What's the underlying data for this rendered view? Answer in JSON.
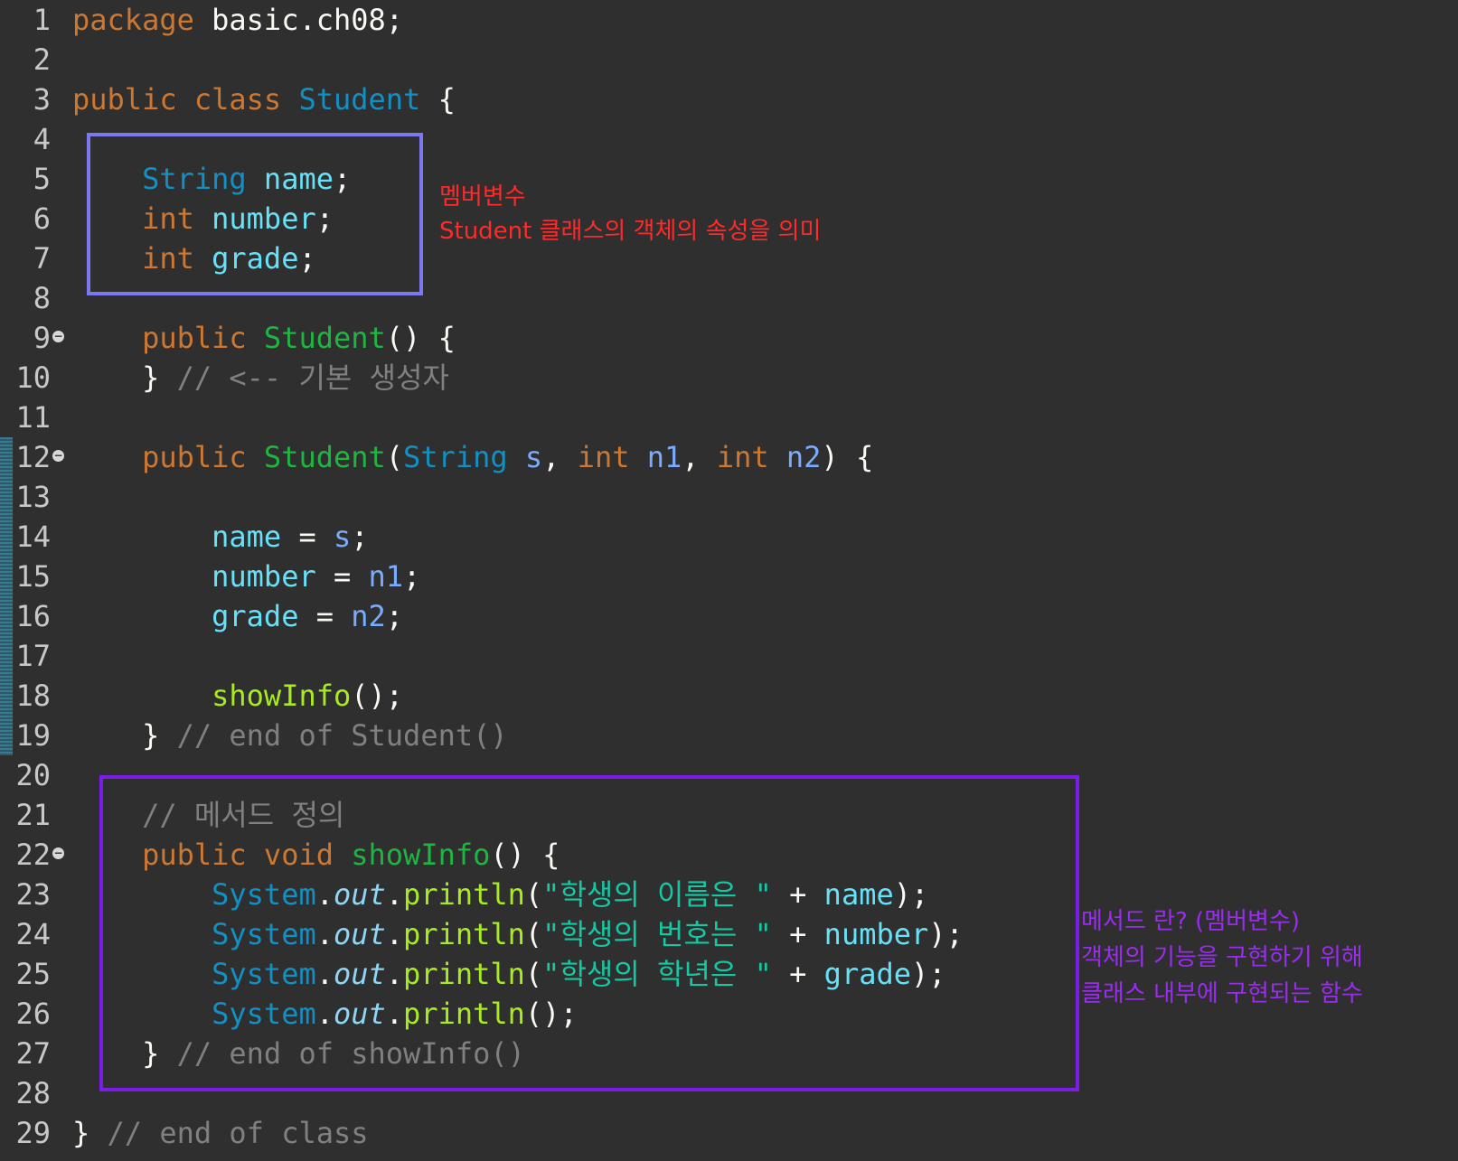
{
  "editor": {
    "lines": [
      {
        "n": "1",
        "tokens": [
          {
            "c": "kw",
            "t": "package"
          },
          {
            "c": "pl",
            "t": " basic.ch08;"
          }
        ]
      },
      {
        "n": "2",
        "tokens": []
      },
      {
        "n": "3",
        "tokens": [
          {
            "c": "kw",
            "t": "public class "
          },
          {
            "c": "ty",
            "t": "Student"
          },
          {
            "c": "pl",
            "t": " {"
          }
        ]
      },
      {
        "n": "4",
        "tokens": []
      },
      {
        "n": "5",
        "tokens": [
          {
            "c": "pl",
            "t": "    "
          },
          {
            "c": "ty",
            "t": "String"
          },
          {
            "c": "pl",
            "t": " "
          },
          {
            "c": "fld",
            "t": "name"
          },
          {
            "c": "pl",
            "t": ";"
          }
        ]
      },
      {
        "n": "6",
        "tokens": [
          {
            "c": "pl",
            "t": "    "
          },
          {
            "c": "kw",
            "t": "int"
          },
          {
            "c": "pl",
            "t": " "
          },
          {
            "c": "fld",
            "t": "number"
          },
          {
            "c": "pl",
            "t": ";"
          }
        ]
      },
      {
        "n": "7",
        "tokens": [
          {
            "c": "pl",
            "t": "    "
          },
          {
            "c": "kw",
            "t": "int"
          },
          {
            "c": "pl",
            "t": " "
          },
          {
            "c": "fld",
            "t": "grade"
          },
          {
            "c": "pl",
            "t": ";"
          }
        ]
      },
      {
        "n": "8",
        "tokens": []
      },
      {
        "n": "9",
        "fold": true,
        "tokens": [
          {
            "c": "pl",
            "t": "    "
          },
          {
            "c": "kw",
            "t": "public"
          },
          {
            "c": "pl",
            "t": " "
          },
          {
            "c": "meth",
            "t": "Student"
          },
          {
            "c": "pl",
            "t": "() {"
          }
        ]
      },
      {
        "n": "10",
        "tokens": [
          {
            "c": "pl",
            "t": "    } "
          },
          {
            "c": "cmt",
            "t": "// <-- 기본 생성자"
          }
        ]
      },
      {
        "n": "11",
        "tokens": []
      },
      {
        "n": "12",
        "fold": true,
        "tokens": [
          {
            "c": "pl",
            "t": "    "
          },
          {
            "c": "kw",
            "t": "public"
          },
          {
            "c": "pl",
            "t": " "
          },
          {
            "c": "meth",
            "t": "Student"
          },
          {
            "c": "pl",
            "t": "("
          },
          {
            "c": "ty",
            "t": "String"
          },
          {
            "c": "pl",
            "t": " "
          },
          {
            "c": "param",
            "t": "s"
          },
          {
            "c": "pl",
            "t": ", "
          },
          {
            "c": "kw",
            "t": "int"
          },
          {
            "c": "pl",
            "t": " "
          },
          {
            "c": "param",
            "t": "n1"
          },
          {
            "c": "pl",
            "t": ", "
          },
          {
            "c": "kw",
            "t": "int"
          },
          {
            "c": "pl",
            "t": " "
          },
          {
            "c": "param",
            "t": "n2"
          },
          {
            "c": "pl",
            "t": ") {"
          }
        ]
      },
      {
        "n": "13",
        "tokens": []
      },
      {
        "n": "14",
        "tokens": [
          {
            "c": "pl",
            "t": "        "
          },
          {
            "c": "fld",
            "t": "name"
          },
          {
            "c": "pl",
            "t": " = "
          },
          {
            "c": "param",
            "t": "s"
          },
          {
            "c": "pl",
            "t": ";"
          }
        ]
      },
      {
        "n": "15",
        "tokens": [
          {
            "c": "pl",
            "t": "        "
          },
          {
            "c": "fld",
            "t": "number"
          },
          {
            "c": "pl",
            "t": " = "
          },
          {
            "c": "param",
            "t": "n1"
          },
          {
            "c": "pl",
            "t": ";"
          }
        ]
      },
      {
        "n": "16",
        "tokens": [
          {
            "c": "pl",
            "t": "        "
          },
          {
            "c": "fld",
            "t": "grade"
          },
          {
            "c": "pl",
            "t": " = "
          },
          {
            "c": "param",
            "t": "n2"
          },
          {
            "c": "pl",
            "t": ";"
          }
        ]
      },
      {
        "n": "17",
        "tokens": []
      },
      {
        "n": "18",
        "tokens": [
          {
            "c": "pl",
            "t": "        "
          },
          {
            "c": "call",
            "t": "showInfo"
          },
          {
            "c": "pl",
            "t": "();"
          }
        ]
      },
      {
        "n": "19",
        "tokens": [
          {
            "c": "pl",
            "t": "    } "
          },
          {
            "c": "cmt",
            "t": "// end of Student()"
          }
        ]
      },
      {
        "n": "20",
        "tokens": []
      },
      {
        "n": "21",
        "tokens": [
          {
            "c": "pl",
            "t": "    "
          },
          {
            "c": "cmt",
            "t": "// 메서드 정의"
          }
        ]
      },
      {
        "n": "22",
        "fold": true,
        "tokens": [
          {
            "c": "pl",
            "t": "    "
          },
          {
            "c": "kw",
            "t": "public void"
          },
          {
            "c": "pl",
            "t": " "
          },
          {
            "c": "meth",
            "t": "showInfo"
          },
          {
            "c": "pl",
            "t": "() {"
          }
        ]
      },
      {
        "n": "23",
        "tokens": [
          {
            "c": "pl",
            "t": "        "
          },
          {
            "c": "ty",
            "t": "System"
          },
          {
            "c": "pl",
            "t": "."
          },
          {
            "c": "st",
            "t": "out"
          },
          {
            "c": "pl",
            "t": "."
          },
          {
            "c": "call",
            "t": "println"
          },
          {
            "c": "pl",
            "t": "("
          },
          {
            "c": "str",
            "t": "\"학생의 이름은 \""
          },
          {
            "c": "pl",
            "t": " + "
          },
          {
            "c": "fld",
            "t": "name"
          },
          {
            "c": "pl",
            "t": ");"
          }
        ]
      },
      {
        "n": "24",
        "tokens": [
          {
            "c": "pl",
            "t": "        "
          },
          {
            "c": "ty",
            "t": "System"
          },
          {
            "c": "pl",
            "t": "."
          },
          {
            "c": "st",
            "t": "out"
          },
          {
            "c": "pl",
            "t": "."
          },
          {
            "c": "call",
            "t": "println"
          },
          {
            "c": "pl",
            "t": "("
          },
          {
            "c": "str",
            "t": "\"학생의 번호는 \""
          },
          {
            "c": "pl",
            "t": " + "
          },
          {
            "c": "fld",
            "t": "number"
          },
          {
            "c": "pl",
            "t": ");"
          }
        ]
      },
      {
        "n": "25",
        "tokens": [
          {
            "c": "pl",
            "t": "        "
          },
          {
            "c": "ty",
            "t": "System"
          },
          {
            "c": "pl",
            "t": "."
          },
          {
            "c": "st",
            "t": "out"
          },
          {
            "c": "pl",
            "t": "."
          },
          {
            "c": "call",
            "t": "println"
          },
          {
            "c": "pl",
            "t": "("
          },
          {
            "c": "str",
            "t": "\"학생의 학년은 \""
          },
          {
            "c": "pl",
            "t": " + "
          },
          {
            "c": "fld",
            "t": "grade"
          },
          {
            "c": "pl",
            "t": ");"
          }
        ]
      },
      {
        "n": "26",
        "tokens": [
          {
            "c": "pl",
            "t": "        "
          },
          {
            "c": "ty",
            "t": "System"
          },
          {
            "c": "pl",
            "t": "."
          },
          {
            "c": "st",
            "t": "out"
          },
          {
            "c": "pl",
            "t": "."
          },
          {
            "c": "call",
            "t": "println"
          },
          {
            "c": "pl",
            "t": "();"
          }
        ]
      },
      {
        "n": "27",
        "tokens": [
          {
            "c": "pl",
            "t": "    } "
          },
          {
            "c": "cmt",
            "t": "// end of showInfo()"
          }
        ]
      },
      {
        "n": "28",
        "tokens": []
      },
      {
        "n": "29",
        "tokens": [
          {
            "c": "pl",
            "t": "} "
          },
          {
            "c": "cmt",
            "t": "// end of class"
          }
        ]
      }
    ]
  },
  "annotations": {
    "member_vars": {
      "line1": "멤버변수",
      "line2": "Student 클래스의 객체의 속성을 의미"
    },
    "methods": {
      "line1": "메서드 란? (멤버변수)",
      "line2": "객체의 기능을 구현하기 위해",
      "line3": "클래스 내부에 구현되는 함수"
    }
  },
  "colors": {
    "background": "#2f2f2f",
    "member_box": "#7b78f2",
    "method_box": "#7b1ce8",
    "annotation_red": "#ff2a2a",
    "annotation_purple": "#9a2cf0"
  }
}
